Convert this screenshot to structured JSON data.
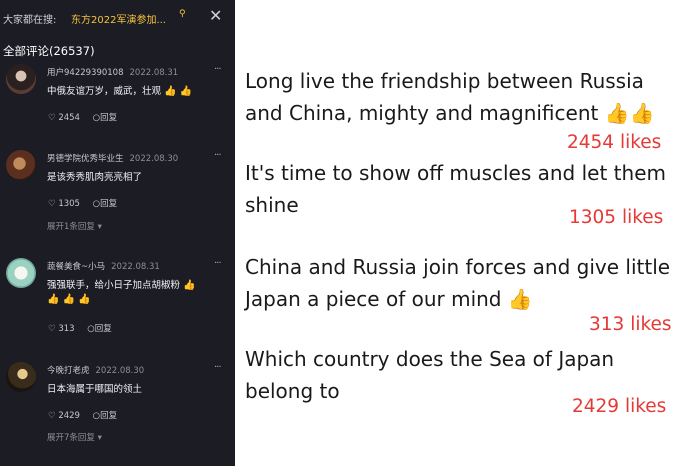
{
  "search": {
    "prefix": "大家都在搜:",
    "query": "东方2022军演参加...",
    "search_icon": "search-icon",
    "close_icon": "close-icon"
  },
  "comments_header": "全部评论(26537)",
  "comments": [
    {
      "user": "用户94229390108",
      "date": "2022.08.31",
      "text": "中俄友谊万岁，威武，壮观",
      "thumbs": "👍 👍",
      "likes": "2454",
      "reply": "回复",
      "expand": ""
    },
    {
      "user": "男德学院优秀毕业生",
      "date": "2022.08.30",
      "text": "是该秀秀肌肉亮亮相了",
      "thumbs": "",
      "likes": "1305",
      "reply": "回复",
      "expand": "展开1条回复"
    },
    {
      "user": "蔬餐美食~小马",
      "date": "2022.08.31",
      "text": "强强联手，给小日子加点胡椒粉",
      "thumbs": "👍",
      "thumbs_line2": "👍 👍 👍",
      "likes": "313",
      "reply": "回复",
      "expand": ""
    },
    {
      "user": "今晚打老虎",
      "date": "2022.08.30",
      "text": "日本海属于哪国的领土",
      "thumbs": "",
      "likes": "2429",
      "reply": "回复",
      "expand": "展开7条回复"
    }
  ],
  "translations": [
    {
      "text": "Long live the friendship between Russia and China, mighty and magnificent",
      "emoji": "👍👍",
      "likes": "2454 likes"
    },
    {
      "text": "It's time to show off muscles and let them shine",
      "emoji": "",
      "likes": "1305 likes"
    },
    {
      "text": "China and Russia join forces and give little Japan a piece of our mind",
      "emoji": "👍",
      "likes": "313 likes"
    },
    {
      "text": "Which country does the Sea of Japan belong to",
      "emoji": "",
      "likes": "2429 likes"
    }
  ],
  "colors": {
    "panel_bg": "#1c1c25",
    "search_highlight": "#f5c33b",
    "likes_red": "#e53935"
  }
}
